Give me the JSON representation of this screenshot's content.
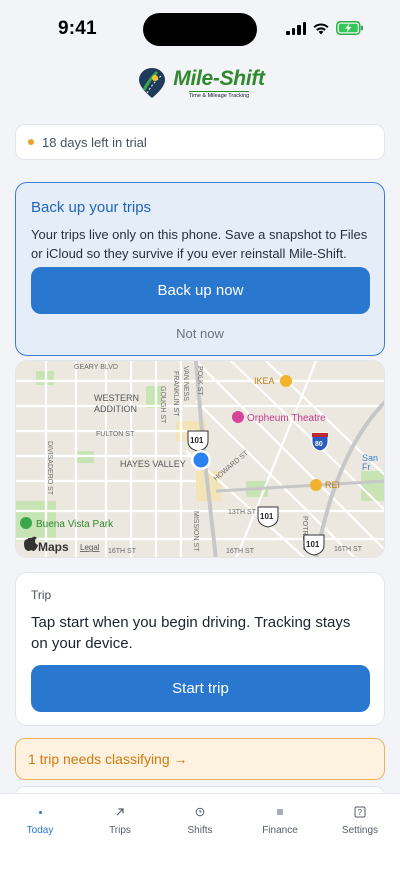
{
  "status_bar": {
    "time": "9:41"
  },
  "logo": {
    "title": "Mile-Shift",
    "tagline": "Time & Mileage Tracking"
  },
  "trial": {
    "text": "18 days left in trial"
  },
  "backup": {
    "title": "Back up your trips",
    "body": "Your trips live only on this phone. Save a snapshot to Files or iCloud so they survive if you ever reinstall Mile-Shift.",
    "primary_label": "Back up now",
    "secondary_label": "Not now"
  },
  "map": {
    "attribution": "Maps",
    "legal": "Legal",
    "labels": {
      "geary": "GEARY BLVD",
      "western_addition_1": "WESTERN",
      "western_addition_2": "ADDITION",
      "fulton": "FULTON ST",
      "hayes_valley": "HAYES VALLEY",
      "divisadero": "DIVISADERO ST",
      "gough": "GOUGH ST",
      "franklin": "FRANKLIN ST",
      "van_ness": "VAN NESS",
      "polk": "POLK ST",
      "ikea": "IKEA",
      "orpheum": "Orpheum Theatre",
      "san_fr_1": "San",
      "san_fr_2": "Fr",
      "rei": "REI",
      "howard": "HOWARD ST",
      "mission": "MISSION ST",
      "st13": "13TH ST",
      "st16a": "16TH ST",
      "st16b": "16TH ST",
      "st16c": "16TH ST",
      "potrero": "POTRERO",
      "buena_vista": "Buena Vista Park",
      "shield_101a": "101",
      "shield_101b": "101",
      "shield_101c": "101",
      "shield_80": "80"
    }
  },
  "trip": {
    "label": "Trip",
    "body": "Tap start when you begin driving. Tracking stays on your device.",
    "button_label": "Start trip"
  },
  "classify": {
    "text": "1 trip needs classifying →"
  },
  "tabs": [
    {
      "label": "Today",
      "icon": "dot-icon",
      "active": true
    },
    {
      "label": "Trips",
      "icon": "arrow-up-right-icon",
      "active": false
    },
    {
      "label": "Shifts",
      "icon": "clock-icon",
      "active": false
    },
    {
      "label": "Finance",
      "icon": "list-icon",
      "active": false
    },
    {
      "label": "Settings",
      "icon": "question-box-icon",
      "active": false
    }
  ],
  "colors": {
    "accent": "#2a77d0",
    "warning": "#d07a10",
    "brand": "#2f8a2f"
  }
}
